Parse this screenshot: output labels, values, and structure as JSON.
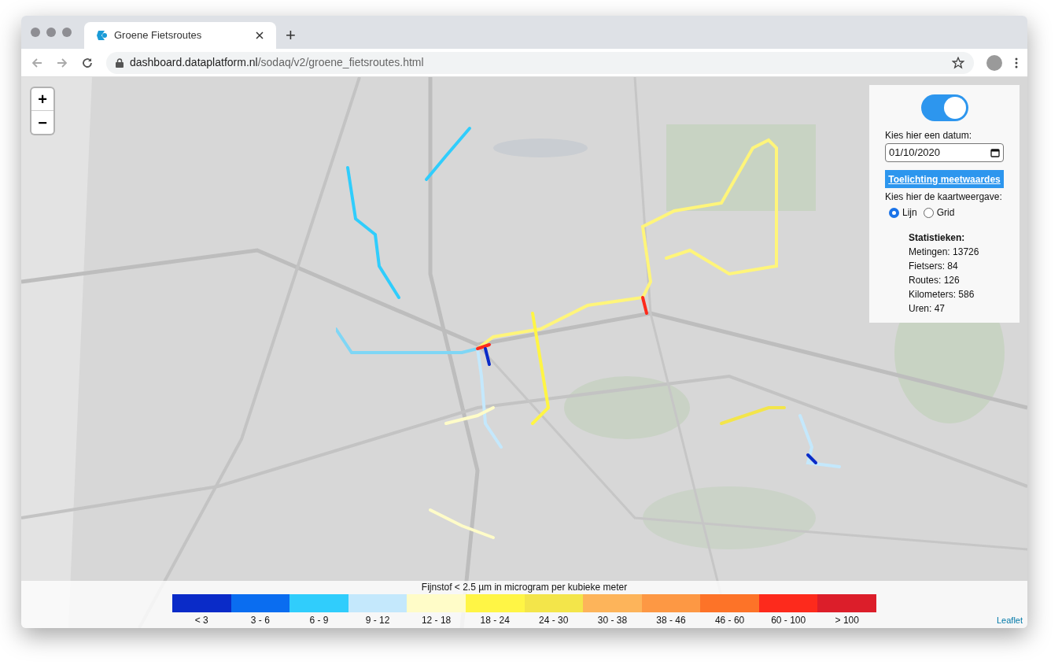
{
  "browser": {
    "tab_title": "Groene Fietsroutes",
    "new_tab": "+",
    "url_host": "dashboard.dataplatform.nl",
    "url_path": "/sodaq/v2/groene_fietsroutes.html"
  },
  "map": {
    "zoom_in": "+",
    "zoom_out": "−",
    "attribution": "Leaflet"
  },
  "panel": {
    "toggle_on": true,
    "date_label": "Kies hier een datum:",
    "date_value": "01/10/2020",
    "info_button": "Toelichting meetwaardes",
    "view_label": "Kies hier de kaartweergave:",
    "view_options": [
      {
        "label": "Lijn",
        "selected": true
      },
      {
        "label": "Grid",
        "selected": false
      }
    ],
    "stats_title": "Statistieken:",
    "stats": [
      "Metingen: 13726",
      "Fietsers: 84",
      "Routes: 126",
      "Kilometers: 586",
      "Uren: 47"
    ]
  },
  "legend": {
    "title": "Fijnstof < 2.5 µm in microgram per kubieke meter",
    "items": [
      {
        "label": "< 3",
        "color": "#0a2bc8"
      },
      {
        "label": "3 - 6",
        "color": "#0a6df0"
      },
      {
        "label": "6 - 9",
        "color": "#30cdfc"
      },
      {
        "label": "9 - 12",
        "color": "#c4e8fc"
      },
      {
        "label": "12 - 18",
        "color": "#fffcc8"
      },
      {
        "label": "18 - 24",
        "color": "#fff545"
      },
      {
        "label": "24 - 30",
        "color": "#f3e54a"
      },
      {
        "label": "30 - 38",
        "color": "#fdb45a"
      },
      {
        "label": "38 - 46",
        "color": "#fd9844"
      },
      {
        "label": "46 - 60",
        "color": "#fd7328"
      },
      {
        "label": "60 - 100",
        "color": "#fd2a1c"
      },
      {
        "label": "> 100",
        "color": "#dc1e2a"
      }
    ]
  }
}
